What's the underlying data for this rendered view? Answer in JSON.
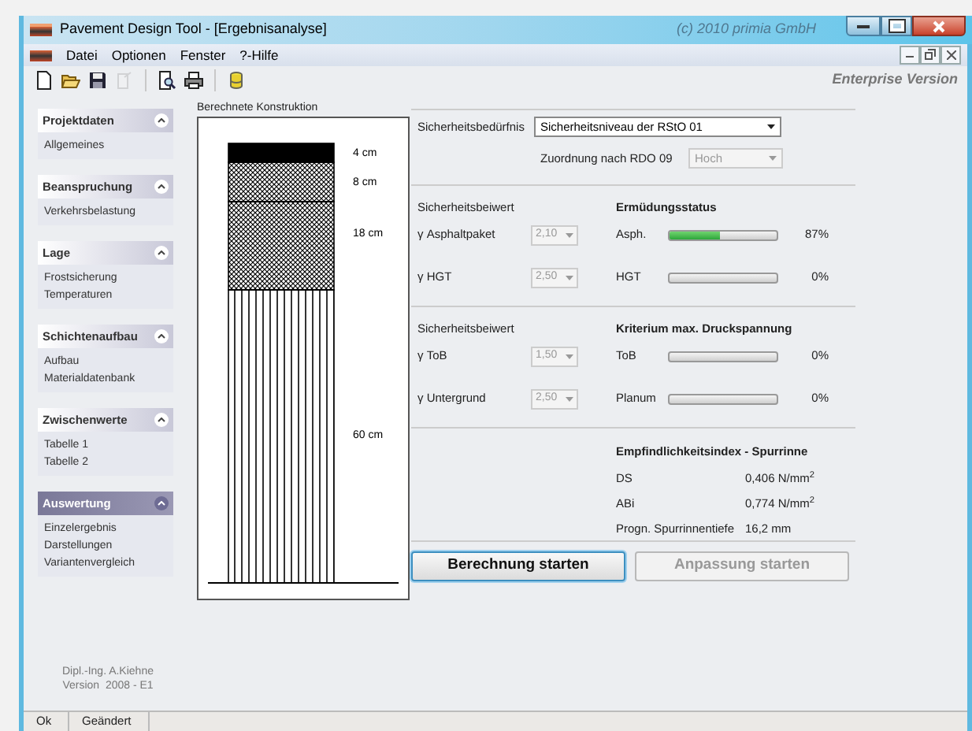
{
  "window": {
    "title": "Pavement Design Tool - [Ergebnisanalyse]",
    "copyright": "(c) 2010 primia GmbH"
  },
  "menu": [
    "Datei",
    "Optionen",
    "Fenster",
    "?-Hilfe"
  ],
  "toolbar": [
    {
      "kind": "new",
      "disabled": false
    },
    {
      "kind": "open",
      "disabled": false
    },
    {
      "kind": "save",
      "disabled": false
    },
    {
      "kind": "export",
      "disabled": true
    },
    {
      "kind": "preview",
      "disabled": false
    },
    {
      "kind": "print",
      "disabled": false
    },
    {
      "kind": "database",
      "disabled": false
    }
  ],
  "edition": "Enterprise Version",
  "sidebar": [
    {
      "title": "Projektdaten",
      "selected": false,
      "items": [
        "Allgemeines"
      ]
    },
    {
      "title": "Beanspruchung",
      "selected": false,
      "items": [
        "Verkehrsbelastung"
      ]
    },
    {
      "title": "Lage",
      "selected": false,
      "items": [
        "Frostsicherung",
        "Temperaturen"
      ]
    },
    {
      "title": "Schichtenaufbau",
      "selected": false,
      "items": [
        "Aufbau",
        "Materialdatenbank"
      ]
    },
    {
      "title": "Zwischenwerte",
      "selected": false,
      "items": [
        "Tabelle 1",
        "Tabelle 2"
      ]
    },
    {
      "title": "Auswertung",
      "selected": true,
      "items": [
        "Einzelergebnis",
        "Darstellungen",
        "Variantenvergleich"
      ]
    }
  ],
  "credits": [
    "Dipl.-Ing. A.Kiehne",
    "Version  2008 - E1"
  ],
  "construction": {
    "title": "Berechnete Konstruktion",
    "layers": [
      {
        "kind": "solid",
        "label": "4 cm"
      },
      {
        "kind": "crosshatch",
        "label": "8 cm"
      },
      {
        "kind": "crosshatch",
        "label": "18 cm"
      },
      {
        "kind": "vertical",
        "label": "60 cm"
      }
    ]
  },
  "safety": {
    "label": "Sicherheitsbedürfnis",
    "value": "Sicherheitsniveau der RStO 01",
    "disabled": false,
    "assignment_label": "Zuordnung nach RDO 09",
    "assignment_value": "Hoch",
    "assignment_disabled": true
  },
  "groups": [
    {
      "left_title": "Sicherheitsbeiwert",
      "left_rows": [
        {
          "label": "γ Asphaltpaket",
          "value": "2,10",
          "disabled": true
        },
        {
          "label": "γ HGT",
          "value": "2,50",
          "disabled": true
        }
      ],
      "right_title": "Ermüdungsstatus",
      "right_rows": [
        {
          "label": "Asph.",
          "level": 0.47,
          "reading": "87%"
        },
        {
          "label": "HGT",
          "level": 0,
          "reading": "0%"
        }
      ]
    },
    {
      "left_title": "Sicherheitsbeiwert",
      "left_rows": [
        {
          "label": "γ ToB",
          "value": "1,50",
          "disabled": true
        },
        {
          "label": "γ Untergrund",
          "value": "2,50",
          "disabled": true
        }
      ],
      "right_title": "Kriterium max. Druckspannung",
      "right_rows": [
        {
          "label": "ToB",
          "level": 0,
          "reading": "0%"
        },
        {
          "label": "Planum",
          "level": 0,
          "reading": "0%"
        }
      ]
    }
  ],
  "sensitivity": {
    "title": "Empfindlichkeitsindex - Spurrinne",
    "rows": [
      {
        "label": "DS",
        "value": "0,406 N/mm$^{2}$"
      },
      {
        "label": "ABi",
        "value": "0,774 N/mm$^{2}$"
      },
      {
        "label": "Progn. Spurrinnentiefe",
        "value": "16,2 mm"
      }
    ]
  },
  "buttons": [
    {
      "label": "Berechnung starten",
      "disabled": false,
      "focused": true
    },
    {
      "label": "Anpassung starten",
      "disabled": true,
      "focused": false
    }
  ],
  "status_bar": [
    "Ok",
    "Geändert"
  ]
}
